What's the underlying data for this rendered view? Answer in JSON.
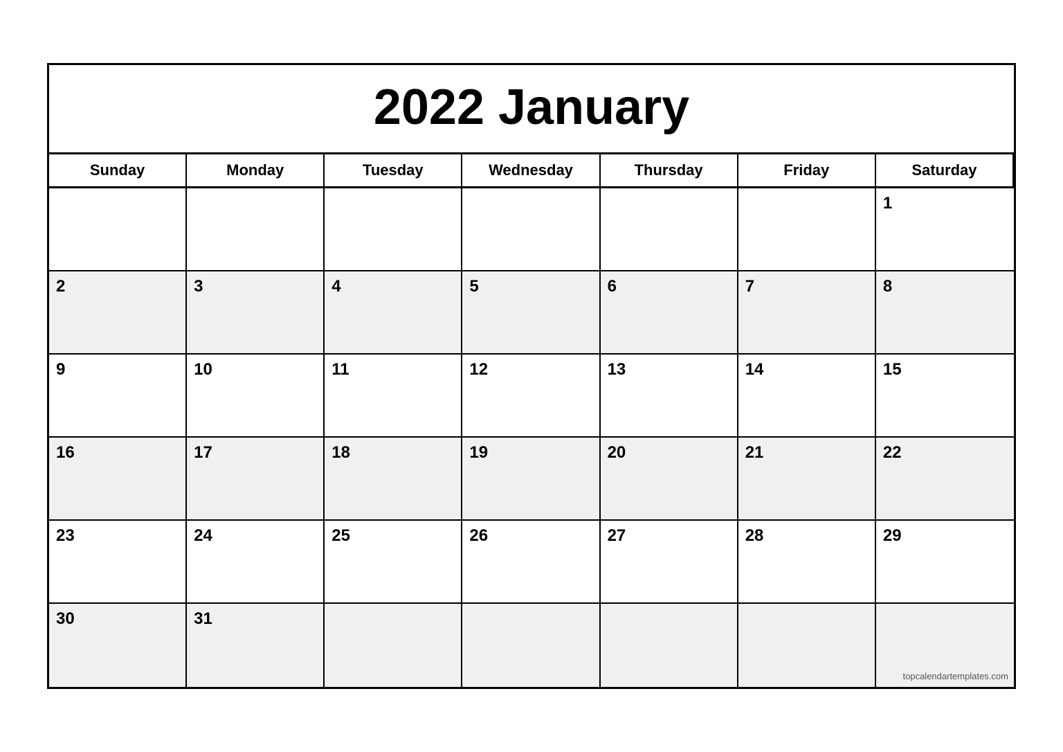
{
  "calendar": {
    "title": "2022 January",
    "headers": [
      "Sunday",
      "Monday",
      "Tuesday",
      "Wednesday",
      "Thursday",
      "Friday",
      "Saturday"
    ],
    "weeks": [
      [
        {
          "day": "",
          "empty": true
        },
        {
          "day": "",
          "empty": true
        },
        {
          "day": "",
          "empty": true
        },
        {
          "day": "",
          "empty": true
        },
        {
          "day": "",
          "empty": true
        },
        {
          "day": "",
          "empty": true
        },
        {
          "day": "1",
          "empty": false
        }
      ],
      [
        {
          "day": "2",
          "empty": false
        },
        {
          "day": "3",
          "empty": false
        },
        {
          "day": "4",
          "empty": false
        },
        {
          "day": "5",
          "empty": false
        },
        {
          "day": "6",
          "empty": false
        },
        {
          "day": "7",
          "empty": false
        },
        {
          "day": "8",
          "empty": false
        }
      ],
      [
        {
          "day": "9",
          "empty": false
        },
        {
          "day": "10",
          "empty": false
        },
        {
          "day": "11",
          "empty": false
        },
        {
          "day": "12",
          "empty": false
        },
        {
          "day": "13",
          "empty": false
        },
        {
          "day": "14",
          "empty": false
        },
        {
          "day": "15",
          "empty": false
        }
      ],
      [
        {
          "day": "16",
          "empty": false
        },
        {
          "day": "17",
          "empty": false
        },
        {
          "day": "18",
          "empty": false
        },
        {
          "day": "19",
          "empty": false
        },
        {
          "day": "20",
          "empty": false
        },
        {
          "day": "21",
          "empty": false
        },
        {
          "day": "22",
          "empty": false
        }
      ],
      [
        {
          "day": "23",
          "empty": false
        },
        {
          "day": "24",
          "empty": false
        },
        {
          "day": "25",
          "empty": false
        },
        {
          "day": "26",
          "empty": false
        },
        {
          "day": "27",
          "empty": false
        },
        {
          "day": "28",
          "empty": false
        },
        {
          "day": "29",
          "empty": false
        }
      ],
      [
        {
          "day": "30",
          "empty": false
        },
        {
          "day": "31",
          "empty": false
        },
        {
          "day": "",
          "empty": true
        },
        {
          "day": "",
          "empty": true
        },
        {
          "day": "",
          "empty": true
        },
        {
          "day": "",
          "empty": true
        },
        {
          "day": "",
          "empty": true,
          "watermark": "topcalendartemplates.com"
        }
      ]
    ]
  }
}
